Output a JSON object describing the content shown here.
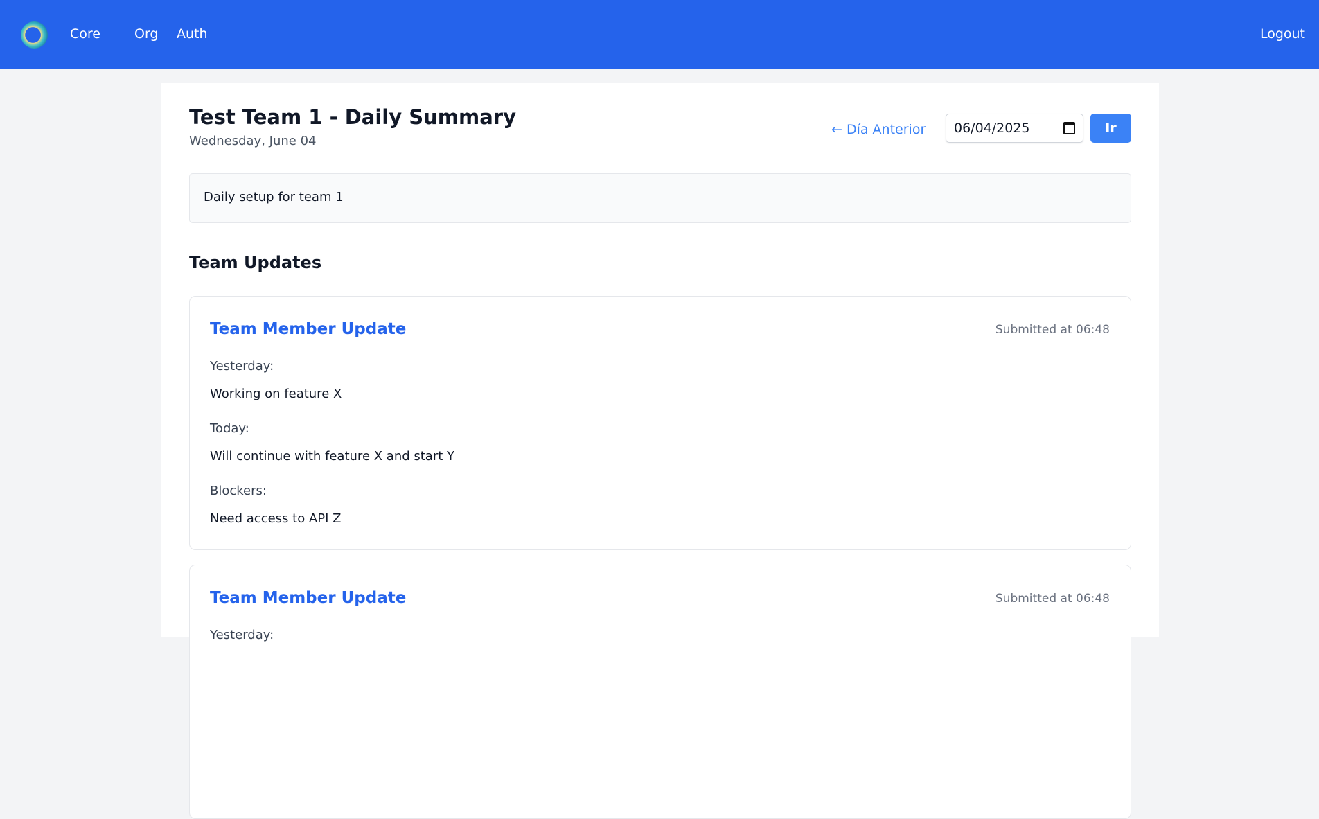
{
  "header": {
    "nav": [
      "Core",
      "Org",
      "Auth"
    ],
    "logout": "Logout"
  },
  "page": {
    "title": "Test Team 1 - Daily Summary",
    "subtitle": "Wednesday, June 04",
    "prev_day": "← Día Anterior",
    "date_value": "06/04/2025",
    "go_button": "Ir",
    "description": "Daily setup for team 1",
    "section_title": "Team Updates"
  },
  "updates": [
    {
      "title": "Team Member Update",
      "submitted": "Submitted at 06:48",
      "yesterday_label": "Yesterday:",
      "yesterday": "Working on feature X",
      "today_label": "Today:",
      "today": "Will continue with feature X and start Y",
      "blockers_label": "Blockers:",
      "blockers": "Need access to API Z"
    },
    {
      "title": "Team Member Update",
      "submitted": "Submitted at 06:48",
      "yesterday_label": "Yesterday:"
    }
  ]
}
